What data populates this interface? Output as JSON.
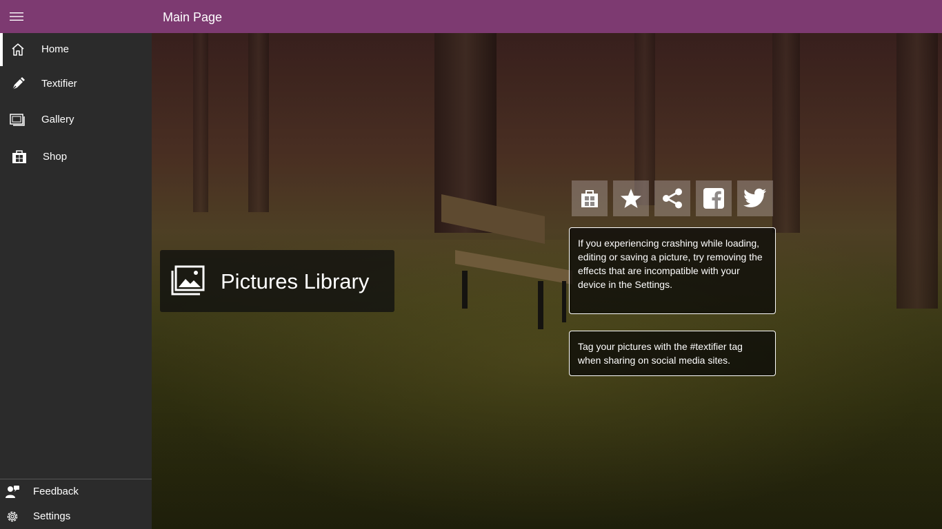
{
  "window": {
    "title": "Main Page"
  },
  "sidebar": {
    "items": [
      {
        "label": "Home",
        "icon": "home-icon",
        "active": true
      },
      {
        "label": "Textifier",
        "icon": "pen-icon",
        "active": false
      },
      {
        "label": "Gallery",
        "icon": "gallery-icon",
        "active": false
      },
      {
        "label": "Shop",
        "icon": "store-icon",
        "active": false
      }
    ],
    "bottom": [
      {
        "label": "Feedback",
        "icon": "feedback-icon"
      },
      {
        "label": "Settings",
        "icon": "gear-icon"
      }
    ]
  },
  "main": {
    "library_tile": {
      "label": "Pictures Library",
      "icon": "pictures-icon"
    },
    "actions": [
      {
        "name": "store",
        "icon": "windows-store-icon"
      },
      {
        "name": "rate",
        "icon": "star-icon"
      },
      {
        "name": "share",
        "icon": "share-icon"
      },
      {
        "name": "facebook",
        "icon": "facebook-icon"
      },
      {
        "name": "twitter",
        "icon": "twitter-icon"
      }
    ],
    "tips": [
      "If you experiencing crashing while loading, editing or saving a picture, try removing the effects that are incompatible with your device in the Settings.",
      "Tag your pictures with the #textifier tag when sharing on social media sites."
    ]
  },
  "colors": {
    "title_bar": "#7d3a71",
    "sidebar": "#2b2b2b",
    "text": "#ffffff"
  }
}
